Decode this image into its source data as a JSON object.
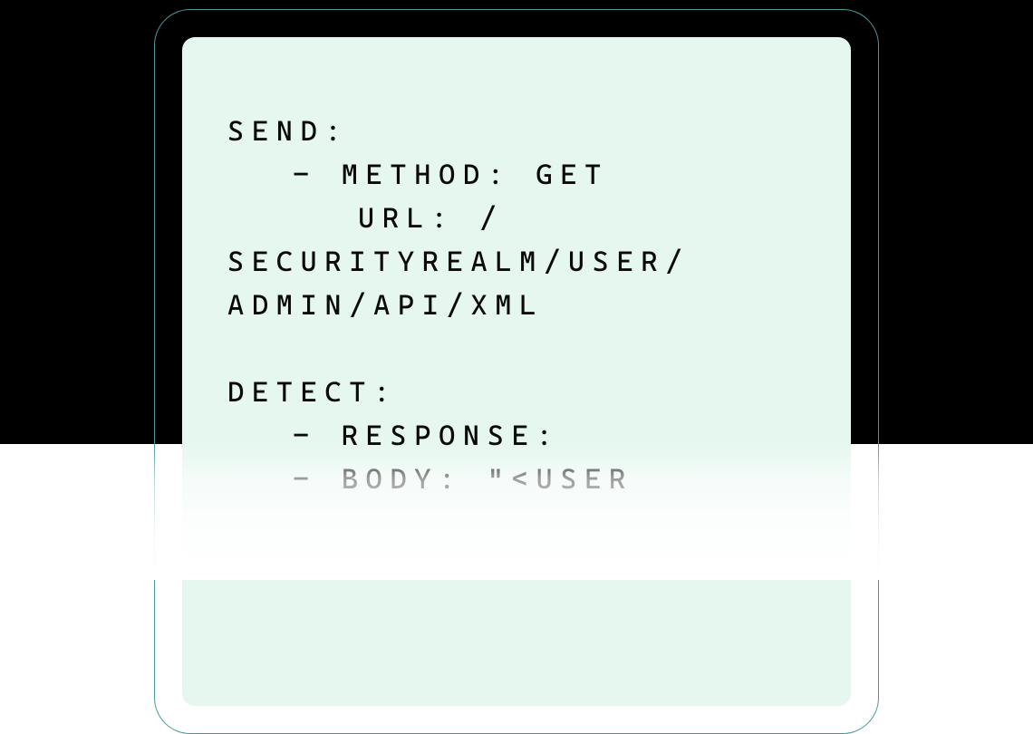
{
  "code": {
    "send": {
      "label": "SEND:",
      "method_line": "- METHOD: GET",
      "url_label": "URL: /",
      "url_path_1": "SECURITYREALM/USER/",
      "url_path_2": "ADMIN/API/XML"
    },
    "detect": {
      "label": "DETECT:",
      "response_line": "- RESPONSE:",
      "body_line": "- BODY: \"<USER"
    }
  }
}
